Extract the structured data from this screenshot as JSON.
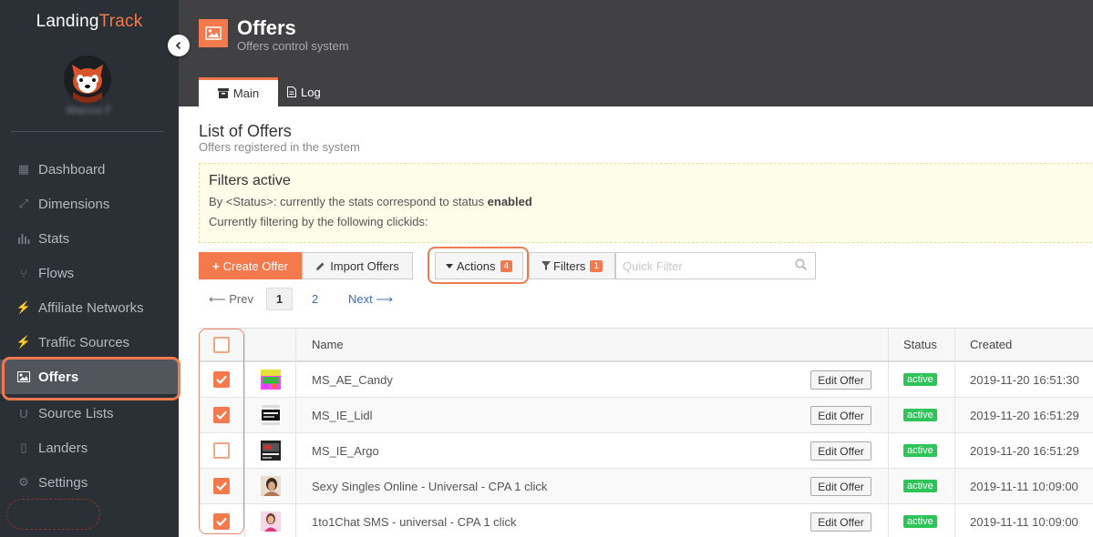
{
  "brand": {
    "primary": "Landing",
    "accent": "Track",
    "accent_color": "#f47a4e"
  },
  "user": {
    "name": "Marcos F"
  },
  "nav": [
    {
      "label": "Dashboard",
      "icon": "dashboard-icon",
      "glyph": "▦"
    },
    {
      "label": "Dimensions",
      "icon": "expand-arrows-icon",
      "glyph": "⤢"
    },
    {
      "label": "Stats",
      "icon": "bar-chart-icon",
      "glyph": "▮"
    },
    {
      "label": "Flows",
      "icon": "fork-icon",
      "glyph": "⑂"
    },
    {
      "label": "Affiliate Networks",
      "icon": "plug-icon",
      "glyph": "⚡"
    },
    {
      "label": "Traffic Sources",
      "icon": "plug-icon",
      "glyph": "⚡"
    },
    {
      "label": "Offers",
      "icon": "image-icon",
      "glyph": "▣"
    },
    {
      "label": "Source Lists",
      "icon": "magnet-icon",
      "glyph": "U"
    },
    {
      "label": "Landers",
      "icon": "file-icon",
      "glyph": "▯"
    },
    {
      "label": "Settings",
      "icon": "gear-icon",
      "glyph": "⚙"
    }
  ],
  "header": {
    "title": "Offers",
    "subtitle": "Offers control system"
  },
  "tabs": [
    {
      "label": "Main"
    },
    {
      "label": "Log"
    }
  ],
  "list": {
    "title": "List of Offers",
    "subtitle": "Offers registered in the system"
  },
  "filters": {
    "title": "Filters active",
    "line1_prefix": "By <Status>: currently the stats correspond to status ",
    "line1_value": "enabled",
    "line2": "Currently filtering by the following clickids:"
  },
  "toolbar": {
    "create_label": "Create Offer",
    "import_label": "Import Offers",
    "actions_label": "Actions",
    "actions_count": "4",
    "filters_label": "Filters",
    "filters_count": "1",
    "quick_filter_placeholder": "Quick Filter"
  },
  "pager": {
    "prev": "Prev",
    "pages": [
      "1",
      "2"
    ],
    "next": "Next"
  },
  "table": {
    "columns": {
      "name": "Name",
      "status": "Status",
      "created": "Created"
    },
    "edit_label": "Edit Offer",
    "rows": [
      {
        "checked": true,
        "name": "MS_AE_Candy",
        "status": "active",
        "created": "2019-11-20 16:51:30",
        "thumb": "candy"
      },
      {
        "checked": true,
        "name": "MS_IE_Lidl",
        "status": "active",
        "created": "2019-11-20 16:51:29",
        "thumb": "lidl"
      },
      {
        "checked": false,
        "name": "MS_IE_Argo",
        "status": "active",
        "created": "2019-11-20 16:51:29",
        "thumb": "argo"
      },
      {
        "checked": true,
        "name": "Sexy Singles Online - Universal - CPA 1 click",
        "status": "active",
        "created": "2019-11-11 10:09:00",
        "thumb": "singles"
      },
      {
        "checked": true,
        "name": "1to1Chat SMS - universal - CPA 1 click",
        "status": "active",
        "created": "2019-11-11 10:09:00",
        "thumb": "chat"
      }
    ]
  }
}
